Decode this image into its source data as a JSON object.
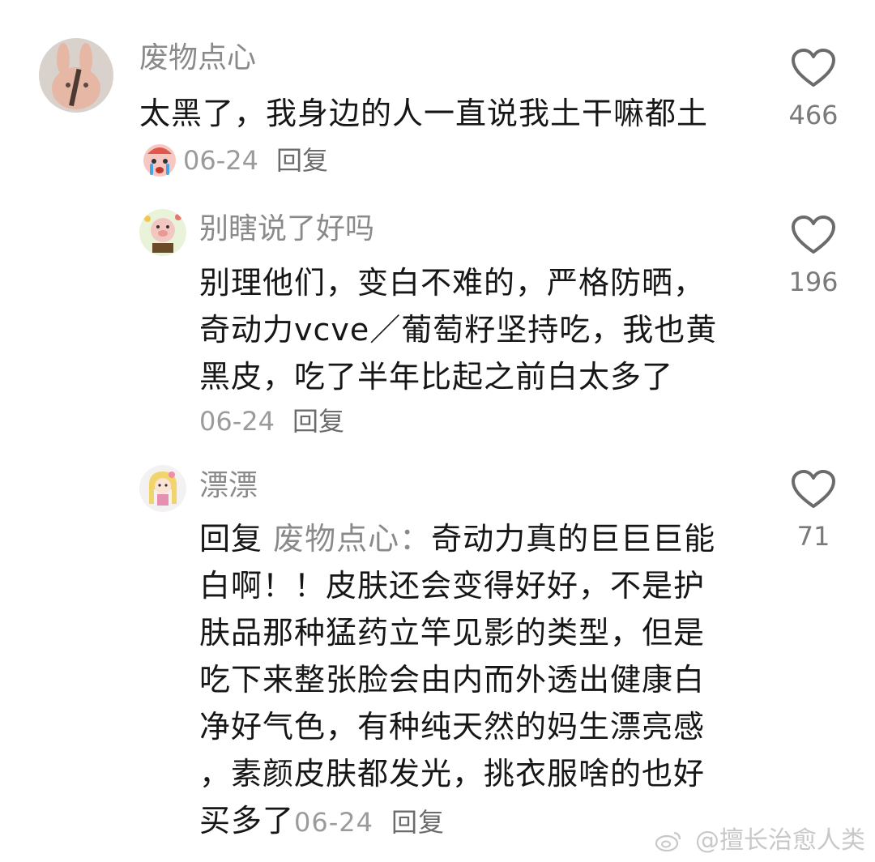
{
  "comments": [
    {
      "username": "废物点心",
      "text": "太黑了，我身边的人一直说我土干嘛都土",
      "date": "06-24",
      "reply_label": "回复",
      "likes": "466",
      "avatar_icon": "bunny-avatar",
      "sticker_icon": "crying-emoji-sticker"
    },
    {
      "username": "别瞎说了好吗",
      "lines": [
        "别理他们，变白不难的，严格防晒，",
        "奇动力vcve／葡萄籽坚持吃，我也黄",
        "黑皮，吃了半年比起之前白太多了"
      ],
      "date": "06-24",
      "reply_label": "回复",
      "likes": "196",
      "avatar_icon": "cartoon-pig-avatar"
    },
    {
      "username": "漂漂",
      "reply_prefix": "回复",
      "reply_target": "废物点心：",
      "first_line_rest": "奇动力真的巨巨巨能",
      "lines": [
        "白啊！！皮肤还会变得好好，不是护",
        "肤品那种猛药立竿见影的类型，但是",
        "吃下来整张脸会由内而外透出健康白",
        "净好气色，有种纯天然的妈生漂亮感",
        "，素颜皮肤都发光，挑衣服啥的也好"
      ],
      "last_line": "买多了",
      "date": "06-24",
      "reply_label": "回复",
      "likes": "71",
      "avatar_icon": "anime-girl-avatar"
    }
  ],
  "watermark": {
    "icon": "weibo-icon",
    "text": "@擅长治愈人类"
  },
  "colors": {
    "text": "#161616",
    "username": "#8a8a8a",
    "meta": "#9b9b9b"
  }
}
